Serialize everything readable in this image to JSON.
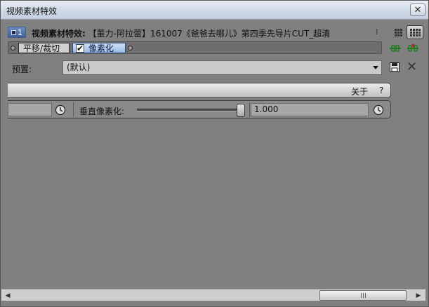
{
  "window": {
    "title": "视频素材特效",
    "close_label": "✕"
  },
  "header": {
    "node_number": "1",
    "prefix": "视频素材特效:",
    "clip_name": "【董力-阿拉蕾】161007《爸爸去哪儿》第四季先导片CUT_超清"
  },
  "chain": {
    "effects": [
      {
        "label": "平移/裁切",
        "selected": false
      },
      {
        "label": "像素化",
        "selected": true,
        "enabled": true
      }
    ],
    "checkmark": "✔"
  },
  "preset": {
    "label": "预置:",
    "value": "(默认)"
  },
  "about_bar": {
    "about_label": "关于",
    "help_label": "?"
  },
  "params": {
    "left_value": "",
    "vertical_label": "垂直像素化:",
    "vertical_value": "1.000",
    "vertical_slider_fraction": 1.0
  },
  "icons": {
    "node": "node-number-icon",
    "more": "more-icon",
    "view_list": "grid-view-icon",
    "view_grid": "large-grid-view-icon",
    "link": "link-keyframe-icon",
    "unlink": "unlink-keyframe-icon",
    "save": "save-icon",
    "delete": "close-icon",
    "keyframe": "clock-icon"
  }
}
